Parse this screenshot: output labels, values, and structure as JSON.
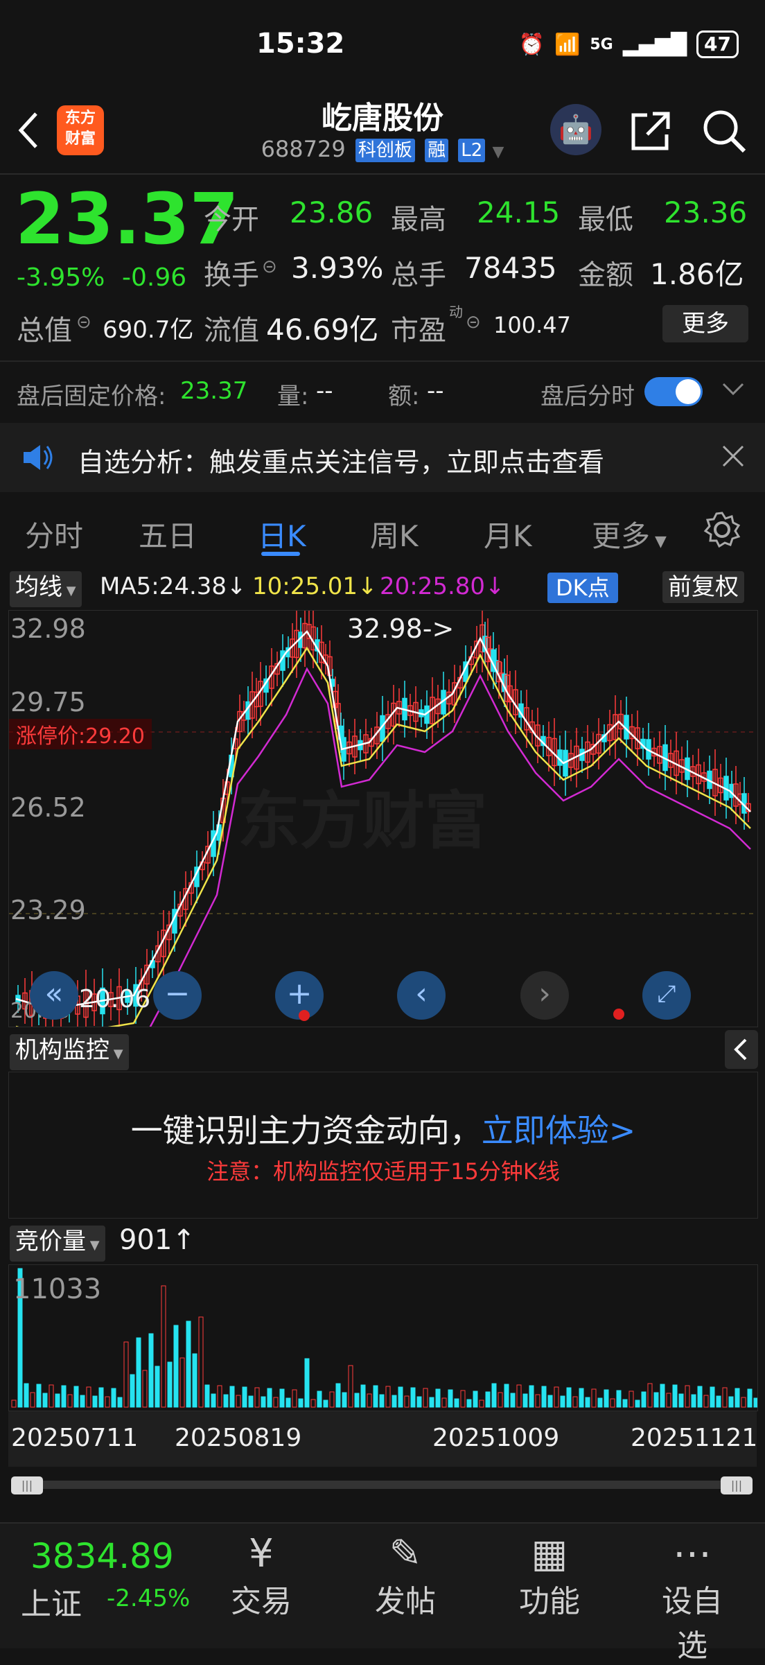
{
  "status": {
    "time": "15:32",
    "signal": "5G",
    "battery": "47"
  },
  "header": {
    "logo_text": "东方\n财富",
    "title": "屹唐股份",
    "code": "688729",
    "tags": [
      "科创板",
      "融",
      "L2"
    ]
  },
  "quote": {
    "price": "23.37",
    "change_pct": "-3.95%",
    "change": "-0.96",
    "open_label": "今开",
    "open": "23.86",
    "high_label": "最高",
    "high": "24.15",
    "low_label": "最低",
    "low": "23.36",
    "turnover_label": "换手",
    "turnover": "3.93%",
    "volume_label": "总手",
    "volume": "78435",
    "amount_label": "金额",
    "amount": "1.86亿",
    "mktcap_label": "总值",
    "mktcap": "690.7亿",
    "float_label": "流值",
    "float": "46.69亿",
    "pe_label": "市盈",
    "pe_sup": "动",
    "pe": "100.47",
    "more_label": "更多"
  },
  "afterhours": {
    "price_label": "盘后固定价格:",
    "price": "23.37",
    "vol_label": "量:",
    "vol": "--",
    "amt_label": "额:",
    "amt": "--",
    "timeshare_label": "盘后分时"
  },
  "notice": {
    "text": "自选分析：触发重点关注信号，立即点击查看"
  },
  "tabs": [
    "分时",
    "五日",
    "日K",
    "周K",
    "月K",
    "更多"
  ],
  "active_tab": "日K",
  "kline": {
    "indicator_label": "均线",
    "ma5": "MA5:24.38↓",
    "ma10": "10:25.01↓",
    "ma20": "20:25.80↓",
    "dk_label": "DK点",
    "adj_label": "前复权",
    "y_ticks": [
      "32.98",
      "29.75",
      "26.52",
      "23.29",
      "20.06"
    ],
    "limit_label": "涨停价:29.20",
    "high_annot": "32.98->",
    "low_annot": "<-20.06",
    "watermark": "东方财富",
    "colors": {
      "up": "#ff3b3b",
      "down": "#26e3f0",
      "ma5": "#ffffff",
      "ma10": "#f0e44a",
      "ma20": "#d22ad2"
    }
  },
  "inst": {
    "label": "机构监控",
    "headline": "一键识别主力资金动向，",
    "link": "立即体验>",
    "note": "注意：机构监控仅适用于15分钟K线"
  },
  "auction": {
    "label": "竞价量",
    "value": "901↑",
    "max": "11033",
    "dates": [
      "20250711",
      "20250819",
      "20251009",
      "20251121"
    ]
  },
  "bottom": {
    "index_value": "3834.89",
    "index_name": "上证",
    "index_change": "-2.45%",
    "nav": [
      "交易",
      "发帖",
      "功能",
      "设自选"
    ]
  }
}
